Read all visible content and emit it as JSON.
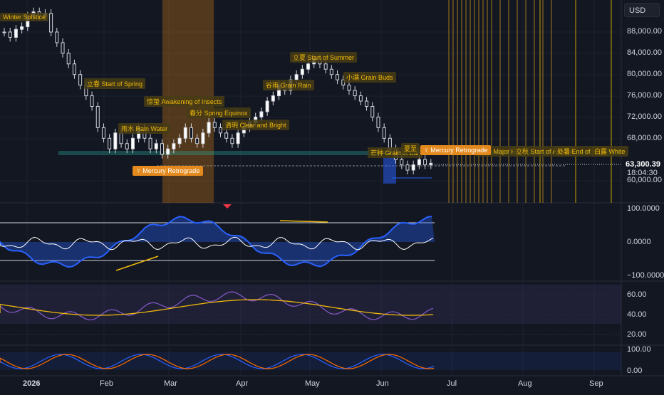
{
  "currency_button": "USD",
  "price_axis": {
    "ticks": [
      "88,000.00",
      "84,000.00",
      "80,000.00",
      "76,000.00",
      "72,000.00",
      "68,000.00",
      "60,000.00"
    ],
    "last_price": "63,300.39",
    "countdown": "18:04:30"
  },
  "time_axis": {
    "labels": [
      "2026",
      "Feb",
      "Mar",
      "Apr",
      "May",
      "Jun",
      "Jul",
      "Aug",
      "Sep"
    ]
  },
  "oscillator_axis": {
    "ticks": [
      "100.0000",
      "0.0000",
      "−100.0000"
    ]
  },
  "rsi_axis": {
    "ticks": [
      "60.00",
      "40.00",
      "20.00"
    ]
  },
  "stoch_axis": {
    "ticks": [
      "100.00",
      "0.00"
    ]
  },
  "events": [
    "Winter Solstice",
    "立春 Start of Spring",
    "惊蛰 Awakening of Insects",
    "雨水 Rain Water",
    "春分 Spring Equinox",
    "清明 Clear and Bright",
    "谷雨 Grain Rain",
    "立夏 Start of Summer",
    "小满 Grain Buds",
    "芒种 Grain in Ear",
    "夏至",
    "大暑 Major Heat",
    "立秋 Start of Autumn",
    "处暑 End of Heat",
    "白露 White"
  ],
  "mercury_labels": [
    "☿ Mercury Retrograde",
    "☿ Mercury Retrograde"
  ],
  "colors": {
    "background": "#131722",
    "up": "#ffffff",
    "down": "#ffffff",
    "accent_orange": "#e3891d",
    "gold": "#f0b90b",
    "osc_blue": "#2962ff",
    "osc_magenta": "#c040c0",
    "rsi_purple": "#7e57c2",
    "rsi_ma": "#f0b90b"
  },
  "price_series": [
    88,
    87,
    88.5,
    89,
    91,
    91.8,
    91,
    91.5,
    88,
    86,
    84,
    82,
    80,
    78,
    76,
    74,
    70,
    68,
    66,
    69,
    67,
    66,
    68,
    70,
    68,
    66,
    67,
    65,
    66,
    67,
    68,
    70,
    68,
    67,
    69,
    71,
    70,
    69,
    68,
    67,
    69,
    70,
    71,
    72,
    73,
    75,
    76,
    78,
    77,
    79,
    80,
    81,
    82,
    83,
    82,
    81,
    80,
    79,
    78,
    77,
    76,
    75,
    74,
    72,
    70,
    68,
    66,
    64,
    63,
    62,
    63,
    64,
    63,
    63.3
  ]
}
